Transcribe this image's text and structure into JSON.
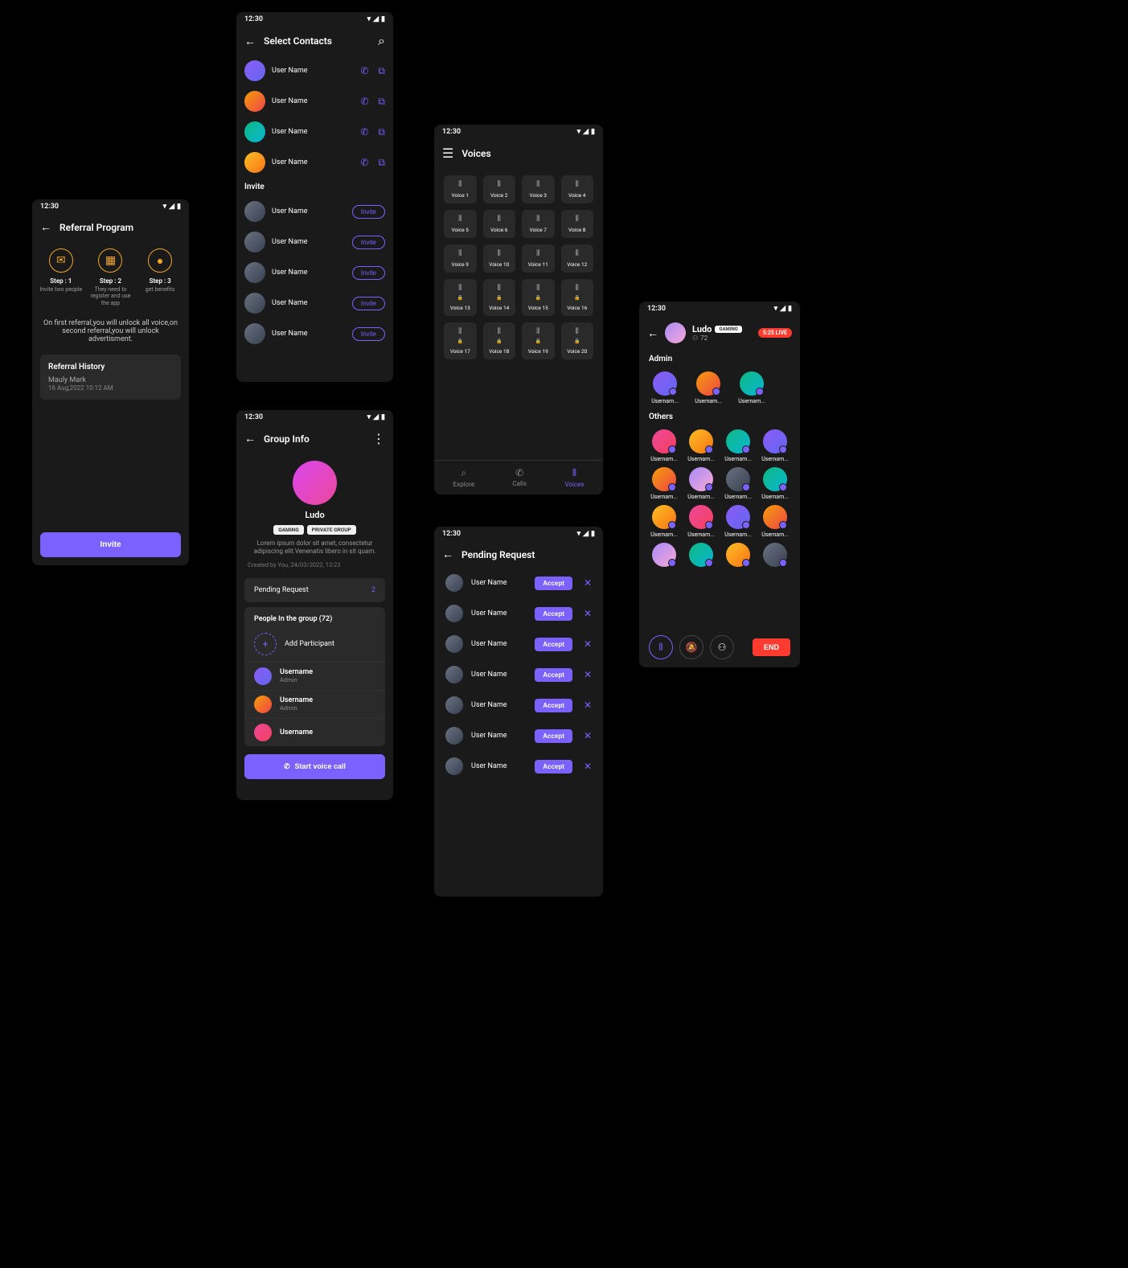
{
  "status": {
    "time": "12:30"
  },
  "referral": {
    "title": "Referral Program",
    "steps": [
      {
        "label": "Step : 1",
        "desc": "Invite two people",
        "icon": "✉"
      },
      {
        "label": "Step : 2",
        "desc": "They need to register and use the app",
        "icon": "▦"
      },
      {
        "label": "Step : 3",
        "desc": "get benefits",
        "icon": "●"
      }
    ],
    "note": "On first referral,you will unlock all voice,on second referral,you will unlock advertisment.",
    "history_title": "Referral History",
    "history_name": "Mauly Mark",
    "history_date": "16 Aug,2022 10:12 AM",
    "invite_btn": "Invite"
  },
  "contacts": {
    "title": "Select Contacts",
    "list": [
      {
        "name": "User Name"
      },
      {
        "name": "User Name"
      },
      {
        "name": "User Name"
      },
      {
        "name": "User Name"
      }
    ],
    "invite_label": "Invite",
    "invite_list": [
      {
        "name": "User Name"
      },
      {
        "name": "User Name"
      },
      {
        "name": "User Name"
      },
      {
        "name": "User Name"
      },
      {
        "name": "User Name"
      }
    ],
    "invite_btn": "Invite"
  },
  "voices": {
    "title": "Voices",
    "tiles": [
      "Voice 1",
      "Voice 2",
      "Voice 3",
      "Voice 4",
      "Voice 5",
      "Voice 6",
      "Voice 7",
      "Voice 8",
      "Voice 9",
      "Voice 10",
      "Voice 11",
      "Voice 12",
      "Voice 13",
      "Voice 14",
      "Voice 15",
      "Voice 16",
      "Voice 17",
      "Voice 18",
      "Voice 19",
      "Voice 20"
    ],
    "nav": {
      "explore": "Explore",
      "calls": "Calls",
      "voices": "Voices"
    }
  },
  "group": {
    "title": "Group Info",
    "name": "Ludo",
    "badges": [
      "GAMING",
      "PRIVATE GROUP"
    ],
    "desc": "Lorem ipsum dolor sit amet, consectetur adipiscing elit.Venenatis libero in sit quam.",
    "meta": "Created by You, 24/03/2022, 13:23",
    "pending_label": "Pending Request",
    "pending_count": "2",
    "people_label": "People In the group (72)",
    "add_label": "Add Participant",
    "members": [
      {
        "name": "Username",
        "role": "Admin"
      },
      {
        "name": "Username",
        "role": "Admin"
      },
      {
        "name": "Username",
        "role": ""
      }
    ],
    "call_btn": "Start voice call"
  },
  "pending": {
    "title": "Pending Request",
    "list": [
      "User Name",
      "User Name",
      "User Name",
      "User Name",
      "User Name",
      "User Name",
      "User Name"
    ],
    "accept": "Accept"
  },
  "live": {
    "name": "Ludo",
    "badge": "GAMING",
    "count": "72",
    "live_label": "5:25 LIVE",
    "admin_label": "Admin",
    "others_label": "Others",
    "admins": [
      "Usernam...",
      "Usernam...",
      "Usernam..."
    ],
    "others": [
      "Usernam...",
      "Usernam...",
      "Usernam...",
      "Usernam...",
      "Usernam...",
      "Usernam...",
      "Usernam...",
      "Usernam...",
      "Usernam...",
      "Usernam...",
      "Usernam...",
      "Usernam...",
      "",
      "",
      "",
      ""
    ],
    "end": "END"
  }
}
